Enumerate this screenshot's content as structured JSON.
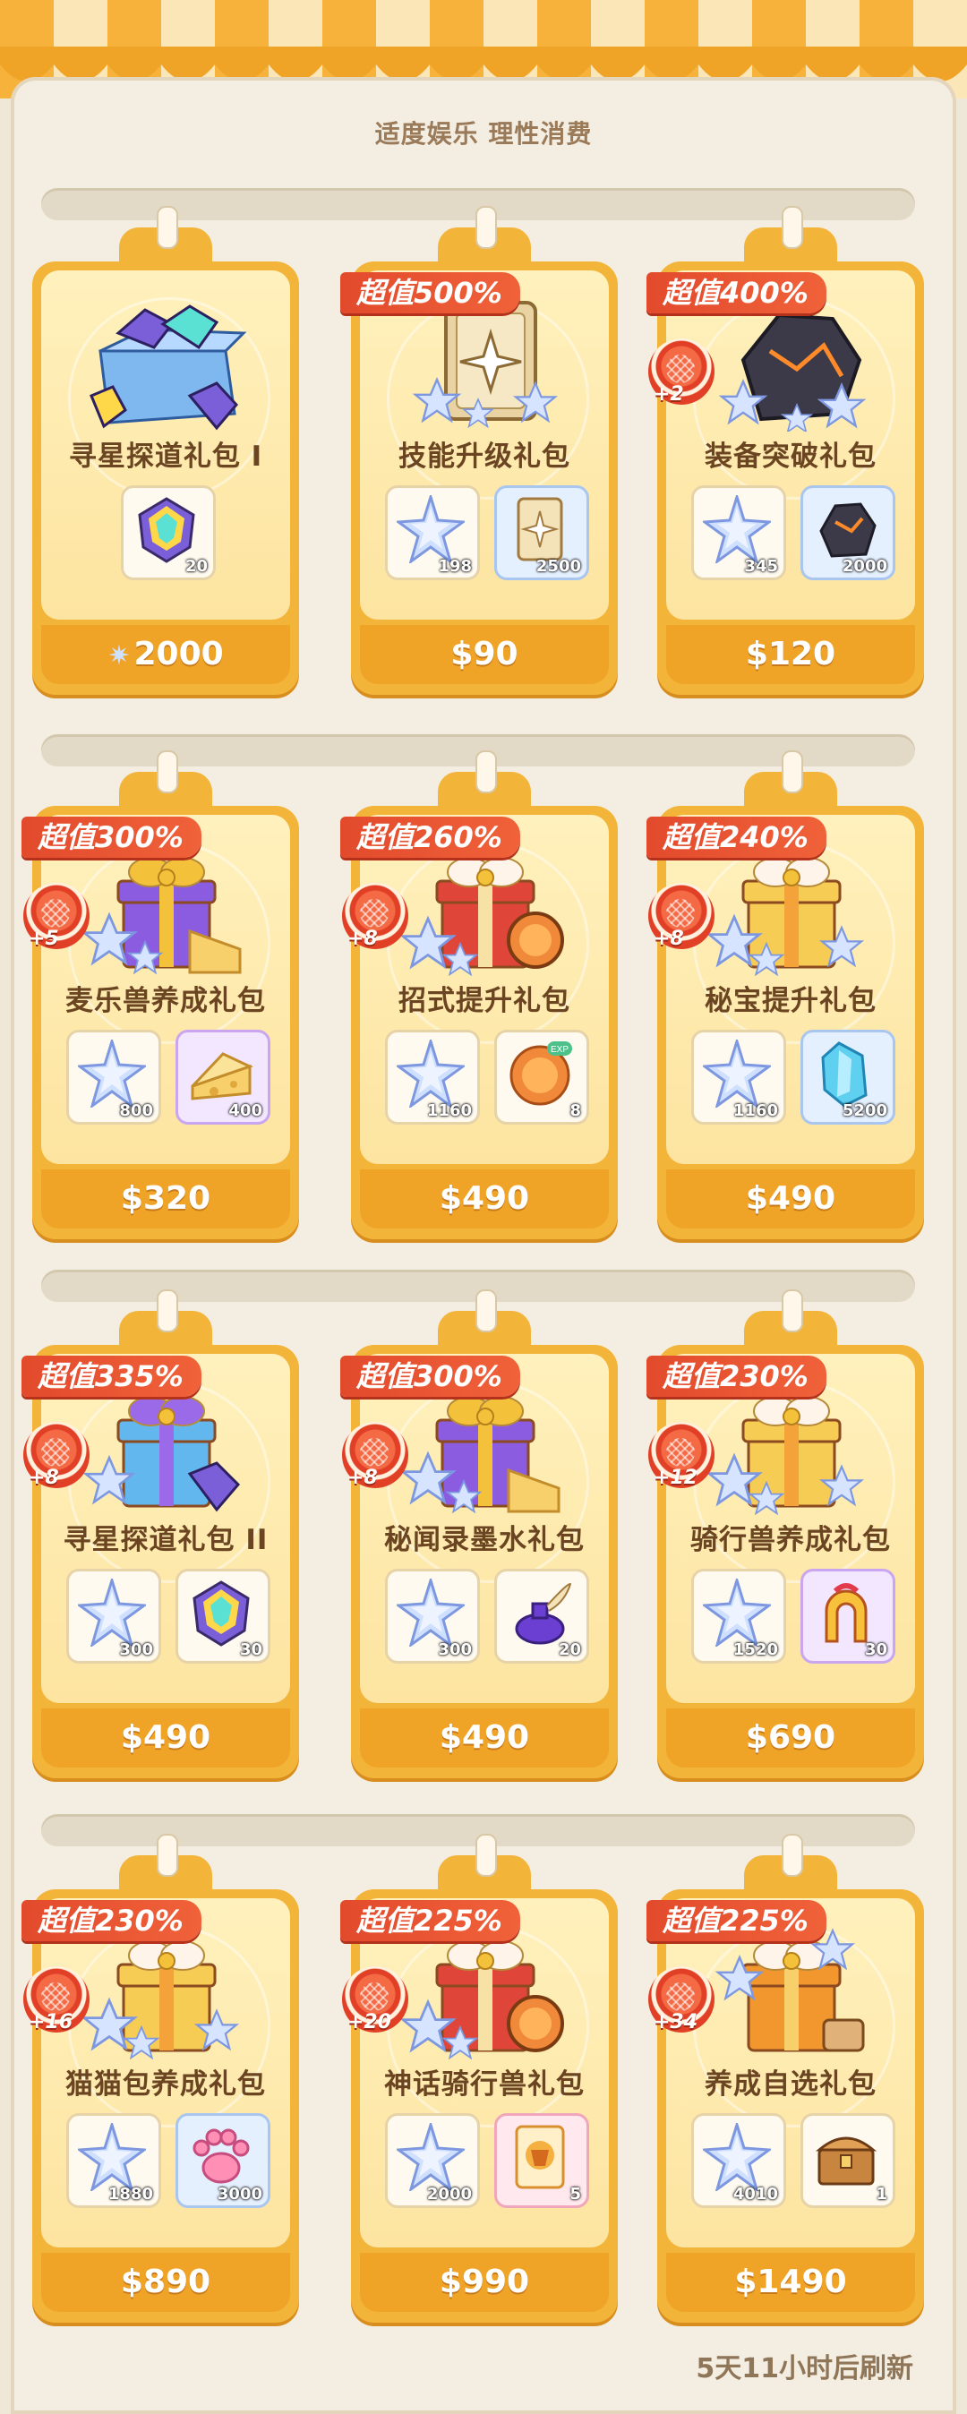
{
  "header": {
    "slogan": "适度娱乐 理性消费"
  },
  "footer": {
    "refresh": "5天11小时后刷新"
  },
  "colors": {
    "card": "#f3b43a",
    "badge": "#e24a2c",
    "price_bar": "#f0a427"
  },
  "cards": [
    {
      "title": "寻星探道礼包 I",
      "price": "2000",
      "price_icon": "star-coin-icon",
      "badge": "",
      "plus": "",
      "art": "crystal-box",
      "items": [
        {
          "icon": "rainbow-gem-icon",
          "qty": "20",
          "tone": ""
        }
      ]
    },
    {
      "title": "技能升级礼包",
      "price": "$90",
      "badge": "超值500%",
      "plus": "",
      "art": "skill-card",
      "items": [
        {
          "icon": "star-crystal-icon",
          "qty": "198",
          "tone": ""
        },
        {
          "icon": "skill-card-icon",
          "qty": "2500",
          "tone": "blue"
        }
      ]
    },
    {
      "title": "装备突破礼包",
      "price": "$120",
      "badge": "超值400%",
      "plus": "+2",
      "art": "ore",
      "items": [
        {
          "icon": "star-crystal-icon",
          "qty": "345",
          "tone": ""
        },
        {
          "icon": "dark-ore-icon",
          "qty": "2000",
          "tone": "blue"
        }
      ]
    },
    {
      "title": "麦乐兽养成礼包",
      "price": "$320",
      "badge": "超值300%",
      "plus": "+5",
      "art": "purple-gift",
      "items": [
        {
          "icon": "star-crystal-icon",
          "qty": "800",
          "tone": ""
        },
        {
          "icon": "cheese-icon",
          "qty": "400",
          "tone": "purple"
        }
      ]
    },
    {
      "title": "招式提升礼包",
      "price": "$490",
      "badge": "超值260%",
      "plus": "+8",
      "art": "red-gift",
      "items": [
        {
          "icon": "star-crystal-icon",
          "qty": "1160",
          "tone": ""
        },
        {
          "icon": "exp-orb-icon",
          "qty": "8",
          "tone": ""
        }
      ]
    },
    {
      "title": "秘宝提升礼包",
      "price": "$490",
      "badge": "超值240%",
      "plus": "+8",
      "art": "gold-gift",
      "items": [
        {
          "icon": "star-crystal-icon",
          "qty": "1160",
          "tone": ""
        },
        {
          "icon": "blue-crystal-icon",
          "qty": "5200",
          "tone": "blue"
        }
      ]
    },
    {
      "title": "寻星探道礼包 II",
      "price": "$490",
      "badge": "超值335%",
      "plus": "+8",
      "art": "blue-gift",
      "items": [
        {
          "icon": "star-crystal-icon",
          "qty": "300",
          "tone": ""
        },
        {
          "icon": "rainbow-gem-icon",
          "qty": "30",
          "tone": ""
        }
      ]
    },
    {
      "title": "秘闻录墨水礼包",
      "price": "$490",
      "badge": "超值300%",
      "plus": "+8",
      "art": "purple-gift",
      "items": [
        {
          "icon": "star-crystal-icon",
          "qty": "300",
          "tone": ""
        },
        {
          "icon": "ink-bottle-icon",
          "qty": "20",
          "tone": ""
        }
      ]
    },
    {
      "title": "骑行兽养成礼包",
      "price": "$690",
      "badge": "超值230%",
      "plus": "+12",
      "art": "gold-gift",
      "items": [
        {
          "icon": "star-crystal-icon",
          "qty": "1520",
          "tone": ""
        },
        {
          "icon": "horseshoe-icon",
          "qty": "30",
          "tone": "purple"
        }
      ]
    },
    {
      "title": "猫猫包养成礼包",
      "price": "$890",
      "badge": "超值230%",
      "plus": "+16",
      "art": "gold-gift",
      "items": [
        {
          "icon": "star-crystal-icon",
          "qty": "1880",
          "tone": ""
        },
        {
          "icon": "paw-icon",
          "qty": "3000",
          "tone": "blue"
        }
      ]
    },
    {
      "title": "神话骑行兽礼包",
      "price": "$990",
      "badge": "超值225%",
      "plus": "+20",
      "art": "red-gift",
      "items": [
        {
          "icon": "star-crystal-icon",
          "qty": "2000",
          "tone": ""
        },
        {
          "icon": "mount-card-icon",
          "qty": "5",
          "tone": "pink"
        }
      ]
    },
    {
      "title": "养成自选礼包",
      "price": "$1490",
      "badge": "超值225%",
      "plus": "+34",
      "art": "orange-gift",
      "items": [
        {
          "icon": "star-crystal-icon",
          "qty": "4010",
          "tone": ""
        },
        {
          "icon": "treasure-chest-icon",
          "qty": "1",
          "tone": ""
        }
      ]
    }
  ]
}
